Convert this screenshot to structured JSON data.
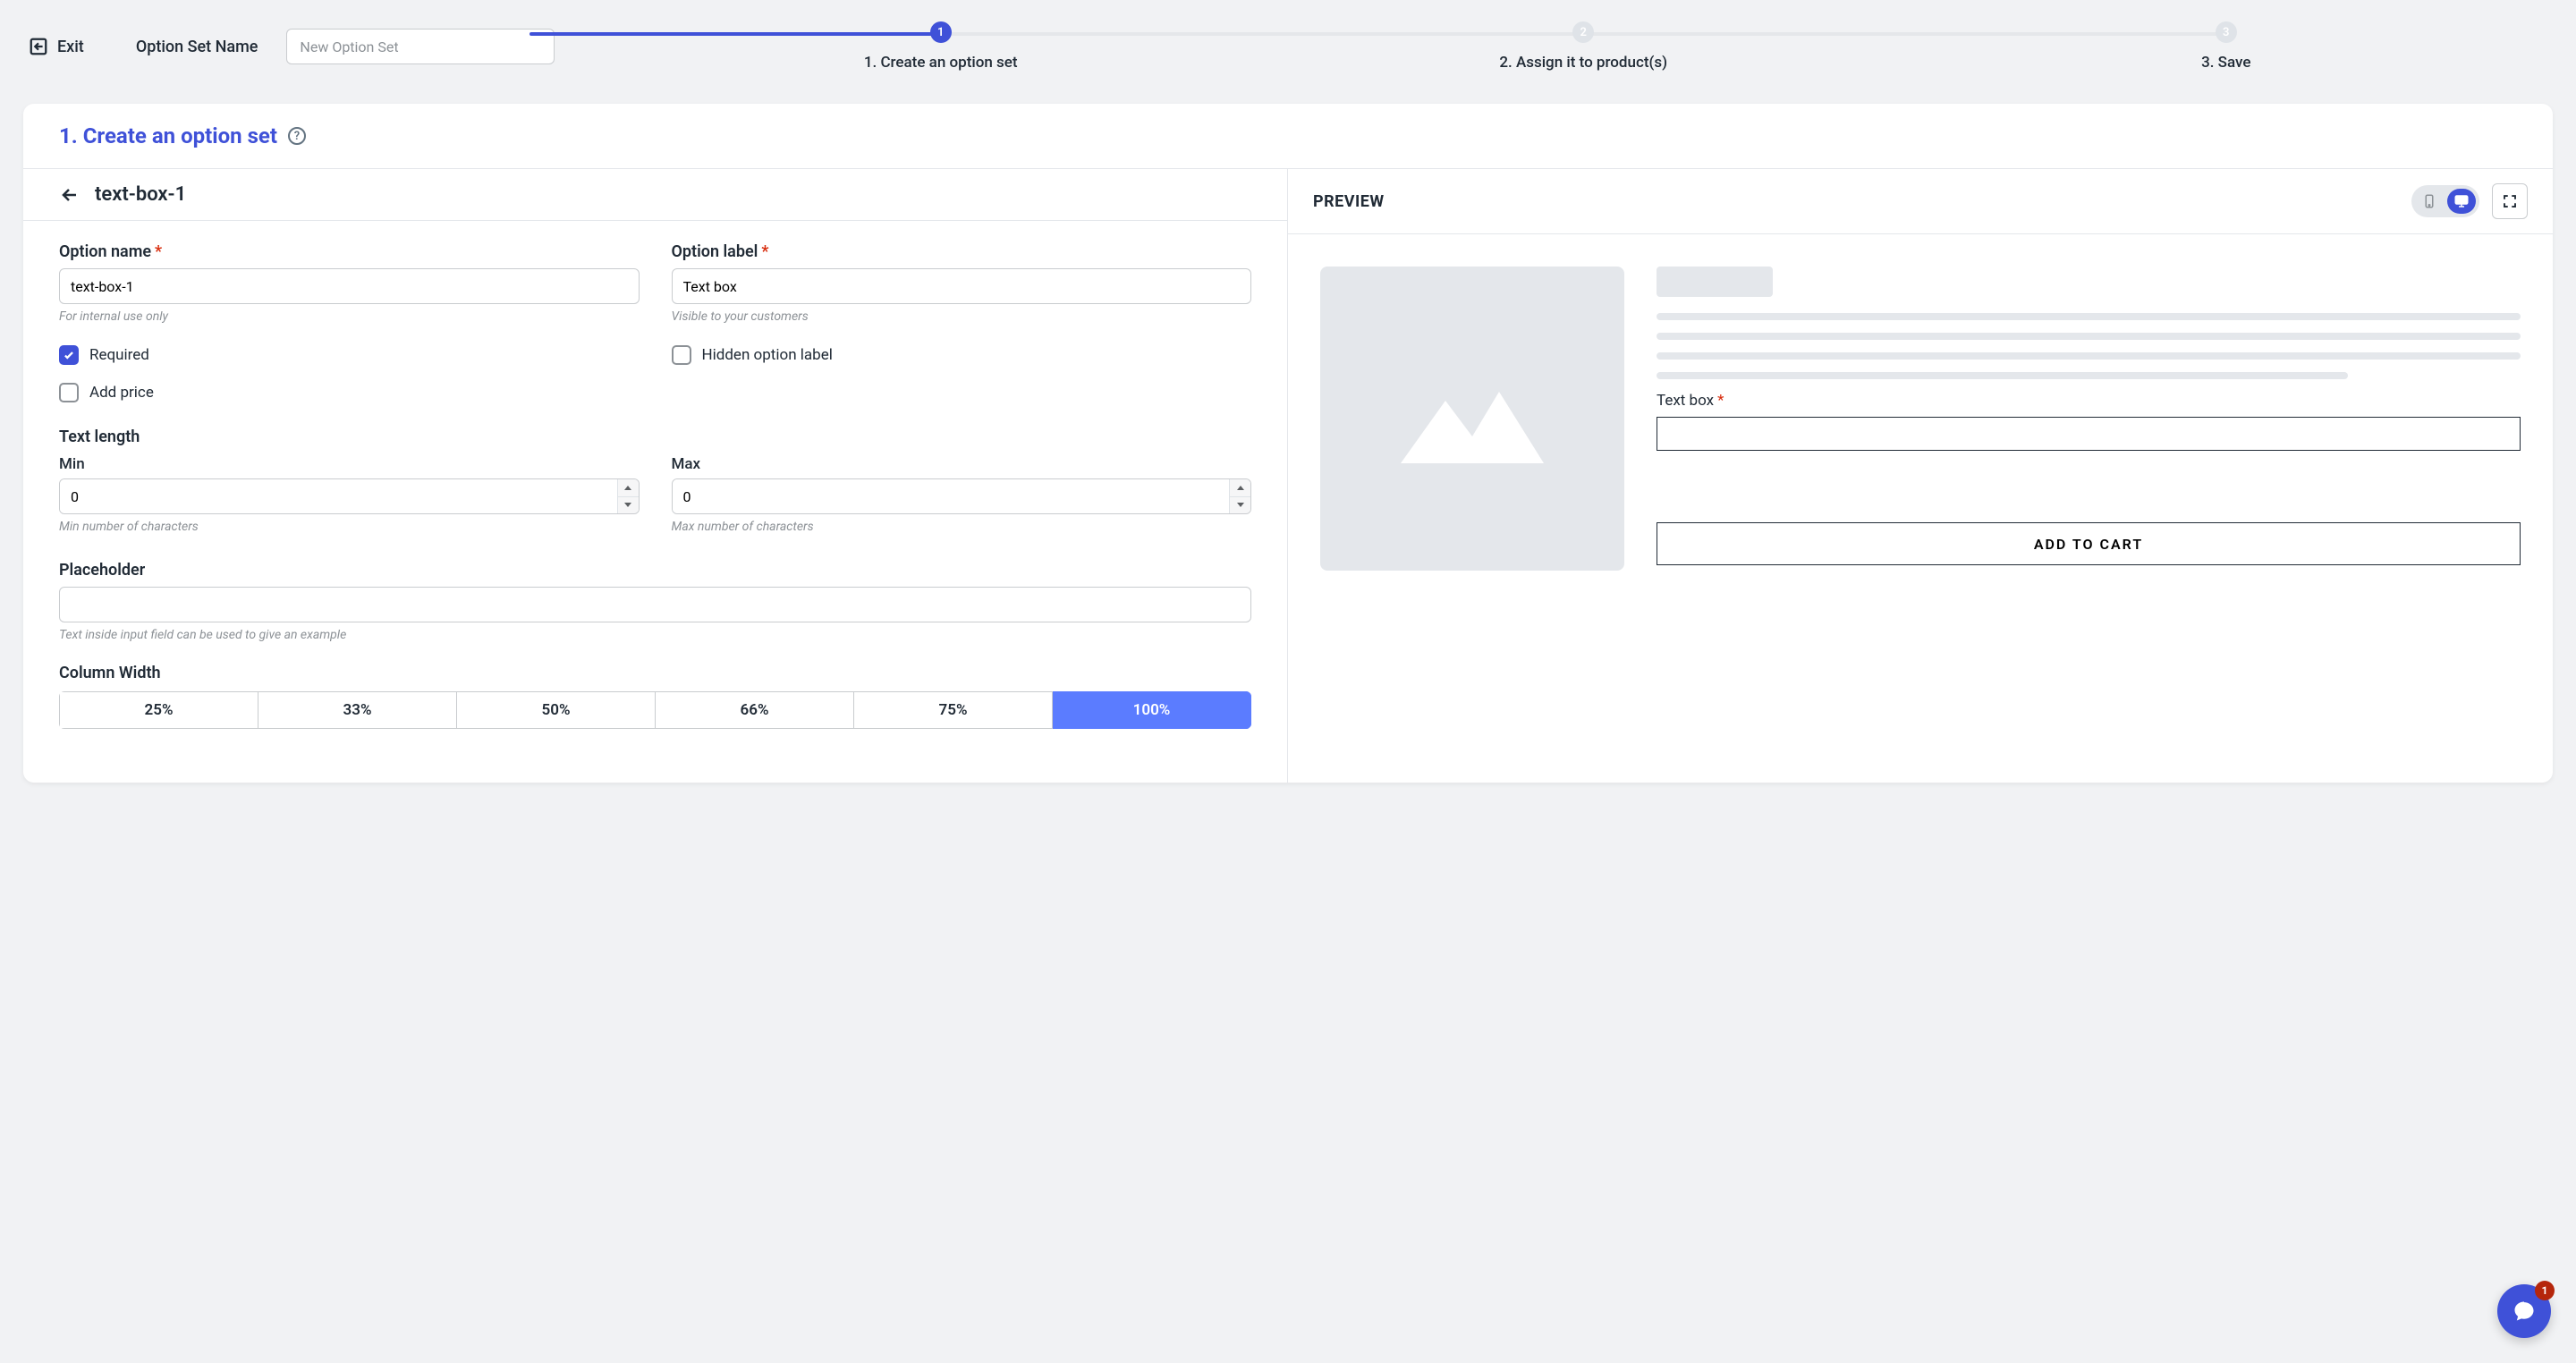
{
  "topbar": {
    "exit_label": "Exit",
    "option_set_name_label": "Option Set Name",
    "option_set_name_placeholder": "New Option Set"
  },
  "stepper": {
    "steps": [
      {
        "num": "1",
        "label": "1. Create an option set",
        "active": true
      },
      {
        "num": "2",
        "label": "2. Assign it to product(s)",
        "active": false
      },
      {
        "num": "3",
        "label": "3. Save",
        "active": false
      }
    ]
  },
  "card": {
    "title": "1. Create an option set",
    "crumb_title": "text-box-1"
  },
  "form": {
    "option_name": {
      "label": "Option name",
      "value": "text-box-1",
      "hint": "For internal use only"
    },
    "option_label": {
      "label": "Option label",
      "value": "Text box",
      "hint": "Visible to your customers"
    },
    "required": {
      "label": "Required",
      "checked": true
    },
    "hidden_label": {
      "label": "Hidden option label",
      "checked": false
    },
    "add_price": {
      "label": "Add price",
      "checked": false
    },
    "text_length_label": "Text length",
    "min": {
      "label": "Min",
      "value": "0",
      "hint": "Min number of characters"
    },
    "max": {
      "label": "Max",
      "value": "0",
      "hint": "Max number of characters"
    },
    "placeholder": {
      "label": "Placeholder",
      "value": "",
      "hint": "Text inside input field can be used to give an example"
    },
    "column_width": {
      "label": "Column Width",
      "options": [
        "25%",
        "33%",
        "50%",
        "66%",
        "75%",
        "100%"
      ],
      "selected": "100%"
    }
  },
  "preview": {
    "title": "PREVIEW",
    "field_label": "Text box",
    "add_to_cart": "ADD TO CART"
  },
  "chat": {
    "badge": "1"
  }
}
